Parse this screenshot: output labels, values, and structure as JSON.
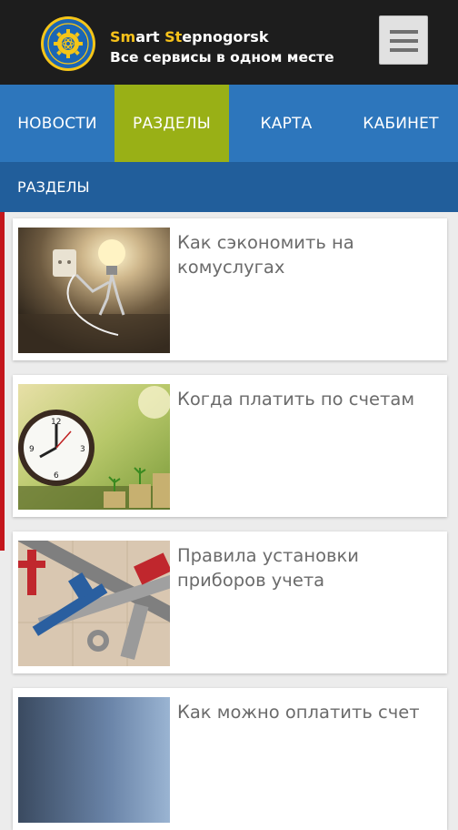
{
  "header": {
    "brand_line1_part1": "Sm",
    "brand_line1_part2": "art ",
    "brand_line1_part3": "St",
    "brand_line1_part4": "epnogorsk",
    "brand_line2": "Все сервисы в одном месте",
    "menu_icon": "hamburger-icon",
    "accent_color": "#f7c21a"
  },
  "tabs": [
    {
      "label": "НОВОСТИ",
      "active": false
    },
    {
      "label": "РАЗДЕЛЫ",
      "active": true
    },
    {
      "label": "КАРТА",
      "active": false
    },
    {
      "label": "КАБИНЕТ",
      "active": false
    }
  ],
  "section": {
    "title": "РАЗДЕЛЫ"
  },
  "cards": [
    {
      "title": "Как сэкономить на комуслугах",
      "image": "lightbulb-plug-photo"
    },
    {
      "title": "Когда платить по счетам",
      "image": "clock-coins-photo"
    },
    {
      "title": "Правила установки приборов учета",
      "image": "pipe-wrenches-photo"
    },
    {
      "title": "Как можно оплатить счет",
      "image": "payment-photo"
    }
  ],
  "colors": {
    "header_bg": "#1d1d1d",
    "tab_bg": "#2d76bc",
    "tab_active_bg": "#99b016",
    "section_bg": "#215e9b",
    "accent_red": "#c4171d"
  }
}
